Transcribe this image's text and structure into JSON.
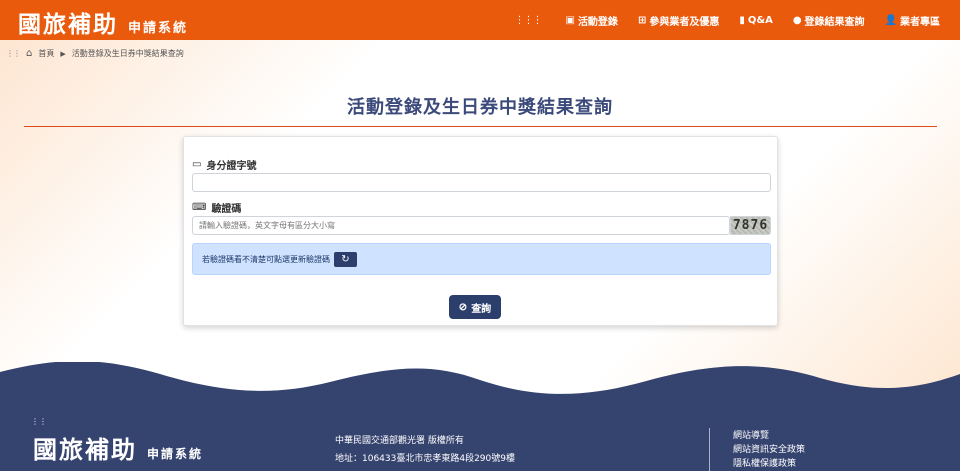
{
  "header": {
    "logo_main": "國旅補助",
    "logo_sub": "申請系統",
    "nav": [
      {
        "label": "活動登錄",
        "icon": "activity-icon"
      },
      {
        "label": "參與業者及優惠",
        "icon": "store-icon"
      },
      {
        "label": "Q&A",
        "icon": "qa-icon"
      },
      {
        "label": "登錄結果查詢",
        "icon": "search-icon"
      },
      {
        "label": "業者專區",
        "icon": "user-icon"
      }
    ]
  },
  "breadcrumb": {
    "home": "首頁",
    "current": "活動登錄及生日券中獎結果查詢"
  },
  "page_title": "活動登錄及生日券中獎結果查詢",
  "form": {
    "id_label": "身分證字號",
    "id_value": "",
    "captcha_label": "驗證碼",
    "captcha_placeholder": "請輸入驗證碼，英文字母有區分大小寫",
    "captcha_code": "7876",
    "alert_text": "若驗證碼看不清楚可點選更新驗證碼",
    "submit_label": "查詢"
  },
  "footer": {
    "logo_main": "國旅補助",
    "logo_sub": "申請系統",
    "owner": "中華民國交通部觀光署 版權所有",
    "address": "地址：106433臺北市忠孝東路4段290號9樓",
    "links": [
      "網站導覽",
      "網站資訊安全政策",
      "隱私權保護政策"
    ]
  },
  "colors": {
    "header_bg": "#ea5a0c",
    "primary": "#2c3e6b",
    "title": "#3b4a7a",
    "footer_bg": "#35436f"
  }
}
